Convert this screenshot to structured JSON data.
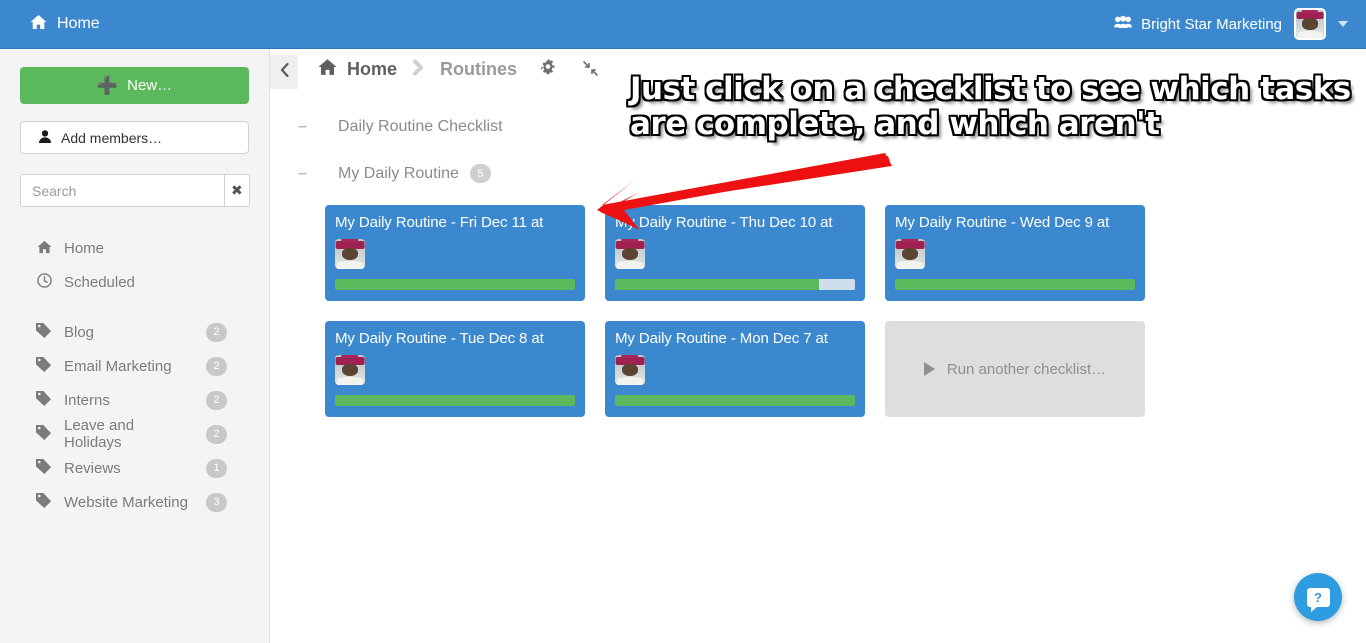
{
  "topbar": {
    "home_label": "Home",
    "home_icon": "home-icon",
    "org_name": "Bright Star Marketing",
    "org_icon": "group-icon",
    "caret_icon": "chevron-down-icon"
  },
  "sidebar": {
    "new_button": "New…",
    "new_icon": "plus-icon",
    "add_members_button": "Add members…",
    "add_members_icon": "person-icon",
    "search": {
      "placeholder": "Search",
      "value": "",
      "clear_label": "✖",
      "clear_icon": "close-icon"
    },
    "nav": [
      {
        "label": "Home",
        "icon": "home-icon",
        "badge": ""
      },
      {
        "label": "Scheduled",
        "icon": "clock-icon",
        "badge": ""
      }
    ],
    "tags": [
      {
        "label": "Blog",
        "icon": "tag-icon",
        "badge": "2"
      },
      {
        "label": "Email Marketing",
        "icon": "tag-icon",
        "badge": "2"
      },
      {
        "label": "Interns",
        "icon": "tag-icon",
        "badge": "2"
      },
      {
        "label": "Leave and Holidays",
        "icon": "tag-icon",
        "badge": "2"
      },
      {
        "label": "Reviews",
        "icon": "tag-icon",
        "badge": "1"
      },
      {
        "label": "Website Marketing",
        "icon": "tag-icon",
        "badge": "3"
      }
    ]
  },
  "breadcrumb": {
    "collapse_icon": "chevron-left-icon",
    "home": "Home",
    "home_icon": "home-icon",
    "separator": "❯",
    "routines": "Routines",
    "gear_icon": "gear-icon",
    "compress_icon": "compress-arrows-icon"
  },
  "tree": [
    {
      "toggle": "–",
      "label": "Daily Routine Checklist",
      "badge": ""
    },
    {
      "toggle": "–",
      "label": "My Daily Routine",
      "badge": "5"
    }
  ],
  "cards": [
    {
      "title": "My Daily Routine - Fri Dec 11 at",
      "progress": 100,
      "avatar": "user-avatar"
    },
    {
      "title": "My Daily Routine - Thu Dec 10 at",
      "progress": 85,
      "avatar": "user-avatar"
    },
    {
      "title": "My Daily Routine - Wed Dec 9 at",
      "progress": 100,
      "avatar": "user-avatar"
    },
    {
      "title": "My Daily Routine - Tue Dec 8 at",
      "progress": 100,
      "avatar": "user-avatar"
    },
    {
      "title": "My Daily Routine - Mon Dec 7 at",
      "progress": 100,
      "avatar": "user-avatar"
    }
  ],
  "run_another": {
    "label": "Run another checklist…",
    "icon": "play-icon"
  },
  "annotation": {
    "line1": "Just click on a checklist to see which tasks",
    "line2": "are complete, and which aren't",
    "arrow_color": "#ee1111"
  },
  "help": {
    "label": "?",
    "icon": "help-chat-icon"
  },
  "colors": {
    "header_blue": "#3b88ce",
    "card_blue": "#3b88ce",
    "progress_green": "#5cb85c",
    "new_green": "#5cb85c",
    "sidebar_gray": "#f4f4f5",
    "run_tile_gray": "#dededf",
    "help_blue": "#2e9ce0"
  }
}
